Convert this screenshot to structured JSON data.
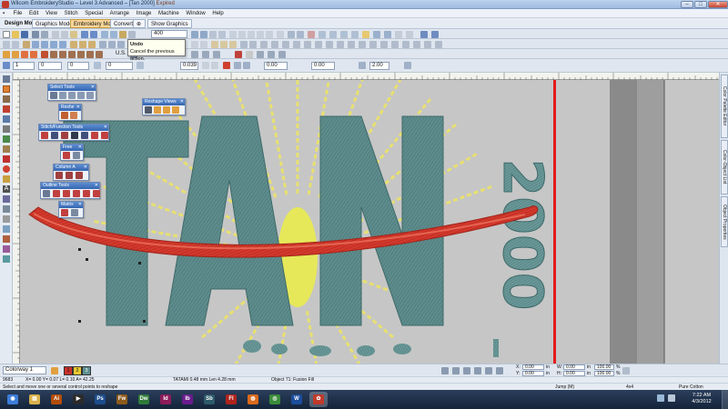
{
  "window": {
    "title": "Wilcom EmbroideryStudio – Level 3 Advanced – [Tan 2000]",
    "expired_badge": "Expired",
    "min": "–",
    "max": "□",
    "close": "✕"
  },
  "menu": [
    "File",
    "Edit",
    "View",
    "Stitch",
    "Special",
    "Arrange",
    "Image",
    "Machine",
    "Window",
    "Help"
  ],
  "modebar": {
    "design_mode": "Design Mode:",
    "graphics_mode": "Graphics Mode",
    "embroidery_mode": "Embroidery Mode",
    "convert": "Convert",
    "show_graphics": "Show Graphics"
  },
  "toolbar": {
    "zoom_value": "400",
    "units": "U.S.",
    "field_1": "1",
    "field_2": "0",
    "field_3": "0.039",
    "field_4": "0.00",
    "field_5": "0.00",
    "field_6": "2.00"
  },
  "tooltip": {
    "title": "Undo",
    "description": "Cancel the previous action."
  },
  "floating_windows": {
    "select_tools": "Select Tools",
    "reshape_views": "Reshape Views",
    "reshape": "Reshe",
    "stitch_function_tools": "Stitch/Function Tools",
    "free": "Free",
    "column_a": "Column A",
    "outline_tools": "Outline Tools",
    "matrix": "Matrix"
  },
  "right_tabs": [
    "Color Palette Editor",
    "Color-Object List",
    "Object Properties"
  ],
  "colorbar": {
    "colorway": "Colorway 1",
    "swatches": [
      {
        "label": "1",
        "color": "#c8302a"
      },
      {
        "label": "2",
        "color": "#e8c830"
      },
      {
        "label": "3",
        "color": "#5d9090"
      }
    ],
    "x_label": "X:",
    "y_label": "Y:",
    "w_label": "W:",
    "h_label": "H:",
    "x_val": "0.00",
    "y_val": "0.00",
    "w_val": "0.00",
    "h_val": "0.00",
    "pct1": "100.00",
    "pct2": "100.00",
    "pct_sign": "%",
    "in_unit": "in"
  },
  "info": {
    "count": "9683",
    "coords": "X= 0.00 Y= 0.07 L= 0.10 A= 42.25",
    "fabric_info": "TATAMI 0.48 mm Len 4.28 mm",
    "object_info": "Object 71: Fusion Fill"
  },
  "status": {
    "hint": "Select and move one or several control points to reshape",
    "jump": "Jump (M)",
    "axis": "4x4",
    "fabric": "Pure Cotton"
  },
  "clock": {
    "time": "7:22 AM",
    "date": "4/3/2012"
  },
  "design": {
    "big_text": "TAN",
    "vertical_text": "2000",
    "colors": {
      "fill": "#5e8c8c",
      "fill_dark": "#3f6a6a",
      "swoosh": "#d4382c",
      "swoosh_light": "#ef7a62",
      "burst": "#e8e070",
      "needle_line": "#e41b1b",
      "guide_dark": "#8a8a8a"
    }
  },
  "taskbar_apps": [
    {
      "name": "start-button",
      "glyph": "◉",
      "color": "#3c7dd9"
    },
    {
      "name": "explorer-app",
      "glyph": "▤",
      "color": "#d9b24a"
    },
    {
      "name": "illustrator-app",
      "glyph": "Ai",
      "color": "#b44d0a"
    },
    {
      "name": "media-app",
      "glyph": "▶",
      "color": "#2b2b2b"
    },
    {
      "name": "photoshop-app",
      "glyph": "Ps",
      "color": "#1c4d8c"
    },
    {
      "name": "fireworks-app",
      "glyph": "Fw",
      "color": "#8c5a1c"
    },
    {
      "name": "dreamweaver-app",
      "glyph": "Dw",
      "color": "#2f7a3a"
    },
    {
      "name": "indesign-app",
      "glyph": "Id",
      "color": "#8c1c5a"
    },
    {
      "name": "indesign2-app",
      "glyph": "Ib",
      "color": "#6a1c8c"
    },
    {
      "name": "soundbooth-app",
      "glyph": "Sb",
      "color": "#2c5a6a"
    },
    {
      "name": "flash-app",
      "glyph": "Fl",
      "color": "#b0231c"
    },
    {
      "name": "firefox-app",
      "glyph": "◍",
      "color": "#d96a1c"
    },
    {
      "name": "chrome-app",
      "glyph": "◎",
      "color": "#3a8c3a"
    },
    {
      "name": "word-app",
      "glyph": "W",
      "color": "#1c4d9c"
    },
    {
      "name": "wilcom-app",
      "glyph": "✿",
      "color": "#c03a2a"
    }
  ]
}
